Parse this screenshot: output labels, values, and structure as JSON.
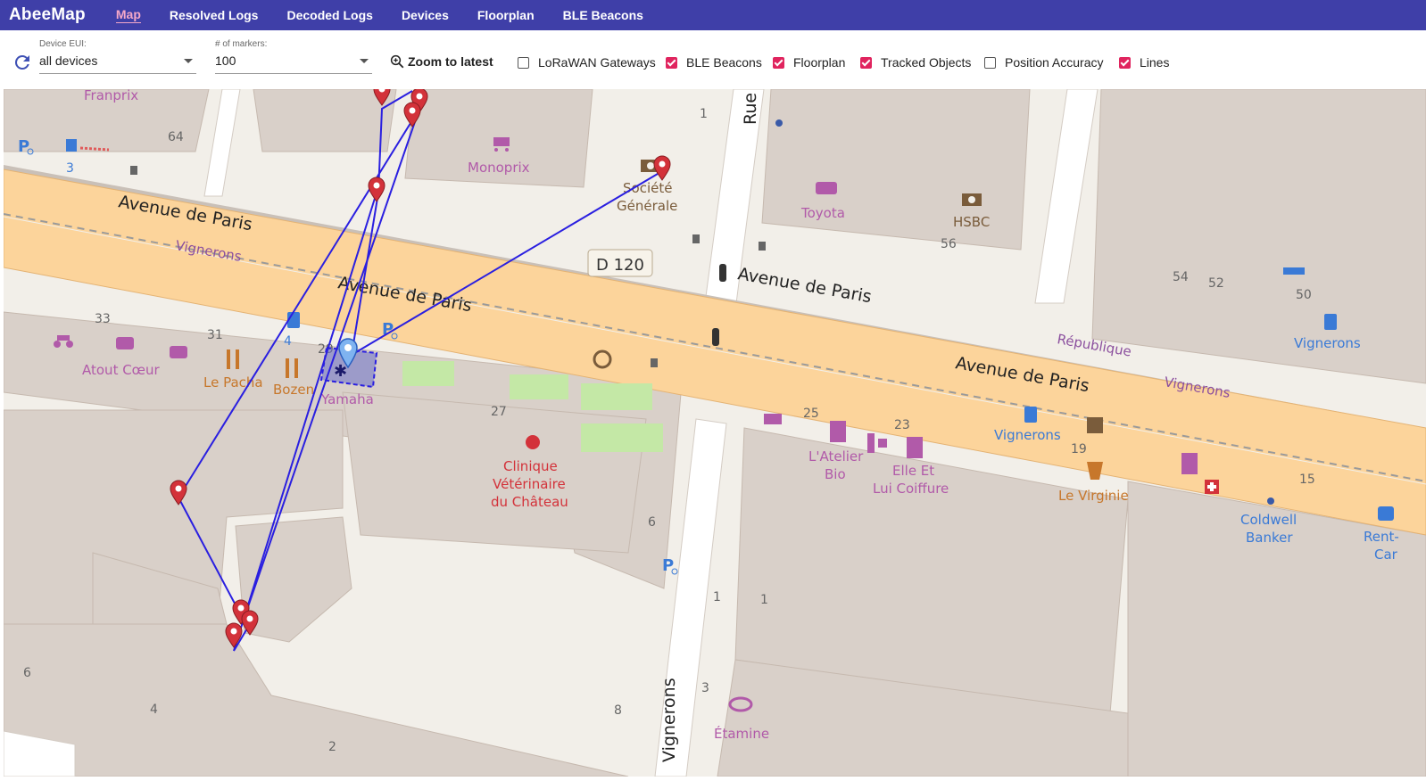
{
  "app": {
    "title": "AbeeMap"
  },
  "nav": [
    {
      "label": "Map",
      "active": true
    },
    {
      "label": "Resolved Logs"
    },
    {
      "label": "Decoded Logs"
    },
    {
      "label": "Devices"
    },
    {
      "label": "Floorplan"
    },
    {
      "label": "BLE Beacons"
    }
  ],
  "toolbar": {
    "device_eui_label": "Device EUI:",
    "device_eui_value": "all devices",
    "markers_label": "# of markers:",
    "markers_value": "100",
    "zoom_label": "Zoom to latest",
    "checkboxes": [
      {
        "label": "LoRaWAN Gateways",
        "checked": false
      },
      {
        "label": "BLE Beacons",
        "checked": true
      },
      {
        "label": "Floorplan",
        "checked": true
      },
      {
        "label": "Tracked Objects",
        "checked": true
      },
      {
        "label": "Position Accuracy",
        "checked": false
      },
      {
        "label": "Lines",
        "checked": true
      }
    ]
  },
  "map": {
    "streets": [
      "Avenue de Paris",
      "Avenue de Paris",
      "Avenue de Paris",
      "Avenue de Paris",
      "Rue",
      "Vignerons",
      "Vignerons",
      "Vignerons",
      "République"
    ],
    "road_ref": "D 120",
    "pois": [
      "Franprix",
      "Monoprix",
      "Société",
      "Générale",
      "Toyota",
      "HSBC",
      "Atout Cœur",
      "Le Pacha",
      "Bozen",
      "Yamaha",
      "Clinique",
      "Vétérinaire",
      "du Château",
      "L'Atelier",
      "Bio",
      "Elle Et",
      "Lui Coiffure",
      "Vignerons",
      "Le Virginie",
      "Coldwell",
      "Banker",
      "Vignerons",
      "Rent-",
      "Car",
      "Étamine"
    ],
    "house_numbers": [
      "64",
      "1",
      "56",
      "54",
      "52",
      "50",
      "33",
      "31",
      "29",
      "27",
      "25",
      "23",
      "19",
      "15",
      "6",
      "1",
      "1",
      "3",
      "6",
      "4",
      "8",
      "2",
      "3",
      "4"
    ],
    "colors": {
      "route_line": "#2a1fe0",
      "marker": "#d3323a",
      "road": "#fcd49b",
      "building": "#d9d0c9",
      "ground": "#f2efe9"
    }
  }
}
